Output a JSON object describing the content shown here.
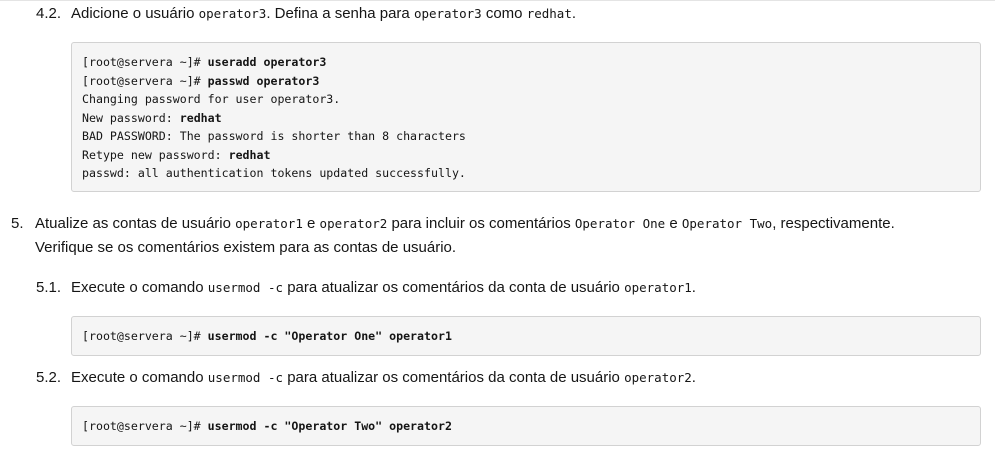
{
  "step_4_2": {
    "number": "4.2.",
    "t1": "Adicione o usuário ",
    "c1": "operator3",
    "t2": ". Defina a senha para ",
    "c2": "operator3",
    "t3": " como ",
    "c3": "redhat",
    "t4": "."
  },
  "code_4_2": {
    "l1_prompt": "[root@servera ~]# ",
    "l1_cmd": "useradd operator3",
    "l2_prompt": "[root@servera ~]# ",
    "l2_cmd": "passwd operator3",
    "l3": "Changing password for user operator3.",
    "l4_label": "New password: ",
    "l4_value": "redhat",
    "l5": "BAD PASSWORD: The password is shorter than 8 characters",
    "l6_label": "Retype new password: ",
    "l6_value": "redhat",
    "l7": "passwd: all authentication tokens updated successfully."
  },
  "step_5": {
    "number": "5.",
    "t1": "Atualize as contas de usuário ",
    "c1": "operator1",
    "t2": " e ",
    "c2": "operator2",
    "t3": " para incluir os comentários ",
    "c3": "Operator One",
    "t4": " e ",
    "c4": "Operator Two",
    "t5": ", respectivamente.",
    "line2": "Verifique se os comentários existem para as contas de usuário."
  },
  "step_5_1": {
    "number": "5.1.",
    "t1": "Execute o comando ",
    "c1": "usermod -c",
    "t2": " para atualizar os comentários da conta de usuário ",
    "c2": "operator1",
    "t3": "."
  },
  "code_5_1": {
    "prompt": "[root@servera ~]# ",
    "cmd": "usermod -c \"Operator One\" operator1"
  },
  "step_5_2": {
    "number": "5.2.",
    "t1": "Execute o comando ",
    "c1": "usermod -c",
    "t2": " para atualizar os comentários da conta de usuário ",
    "c2": "operator2",
    "t3": "."
  },
  "code_5_2": {
    "prompt": "[root@servera ~]# ",
    "cmd": "usermod -c \"Operator Two\" operator2"
  }
}
